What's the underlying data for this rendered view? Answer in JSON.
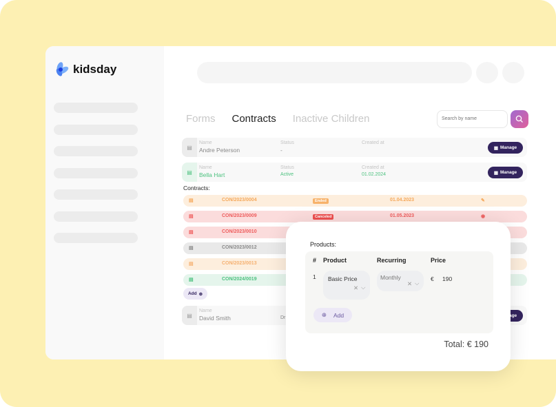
{
  "app": {
    "logo_text": "kidsday"
  },
  "tabs": [
    {
      "label": "Forms"
    },
    {
      "label": "Contracts"
    },
    {
      "label": "Inactive Children"
    }
  ],
  "search": {
    "placeholder": "Search by name"
  },
  "labels": {
    "name": "Name",
    "status": "Status",
    "created": "Created at",
    "manage": "Manage",
    "contracts": "Contracts:",
    "add": "Add"
  },
  "children": [
    {
      "name": "Andre Peterson",
      "status": "-",
      "created": ""
    },
    {
      "name": "Bella Hart",
      "status": "Active",
      "created": "01.02.2024"
    },
    {
      "name": "David Smith",
      "status": "Dr"
    }
  ],
  "contracts": [
    {
      "id": "CON/2023/0004",
      "badge": "Ended",
      "date": "01.04.2023",
      "color": "#fdeedd",
      "text": "#f5a85a",
      "badge_color": "#f7b26a"
    },
    {
      "id": "CON/2023/0009",
      "badge": "Canceled",
      "date": "01.05.2023",
      "color": "#fbdcdc",
      "text": "#ee5b5b",
      "badge_color": "#ee5050"
    },
    {
      "id": "CON/2023/0010",
      "color": "#fbdcdc",
      "text": "#ee5b5b"
    },
    {
      "id": "CON/2023/0012",
      "color": "#e9e9e9",
      "text": "#888888"
    },
    {
      "id": "CON/2023/0013",
      "color": "#fdeedd",
      "text": "#f5b070"
    },
    {
      "id": "CON/2024/0019",
      "color": "#e5f5ec",
      "text": "#4cc17f"
    }
  ],
  "modal": {
    "title": "Products:",
    "headers": [
      "#",
      "Product",
      "Recurring",
      "Price"
    ],
    "row": {
      "index": "1",
      "product": "Basic Price",
      "recurring": "Monthly",
      "currency": "€",
      "price": "190"
    },
    "add": "Add",
    "total": "Total: € 190"
  }
}
